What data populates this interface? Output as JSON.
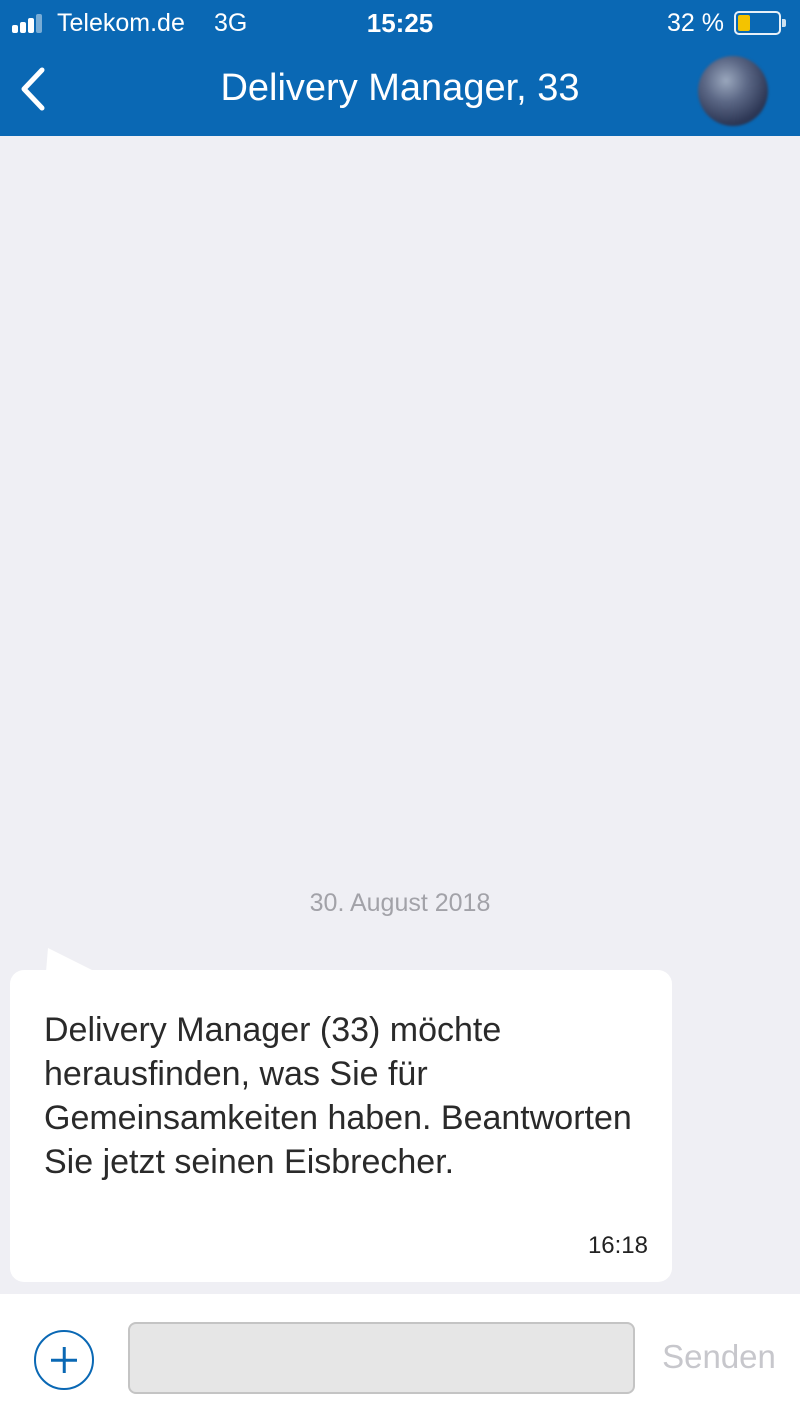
{
  "status_bar": {
    "carrier": "Telekom.de",
    "network": "3G",
    "time": "15:25",
    "battery_percent": "32 %",
    "battery_level": 0.32,
    "battery_color": "#f4c300"
  },
  "nav": {
    "title": "Delivery Manager, 33",
    "back_icon": "chevron-left-icon",
    "avatar": "profile-avatar"
  },
  "chat": {
    "date_separator": "30. August 2018",
    "messages": [
      {
        "text": "Delivery Manager (33) möchte herausfinden, was Sie für Gemeinsamkeiten haben. Beantworten Sie jetzt seinen Eisbrecher.",
        "time": "16:18",
        "direction": "incoming"
      }
    ]
  },
  "composer": {
    "add_icon": "plus-circle-icon",
    "input_value": "",
    "input_placeholder": "",
    "send_label": "Senden"
  },
  "colors": {
    "brand_blue": "#0a68b4",
    "chat_background": "#efeff4",
    "send_disabled": "#c7c7cc"
  }
}
